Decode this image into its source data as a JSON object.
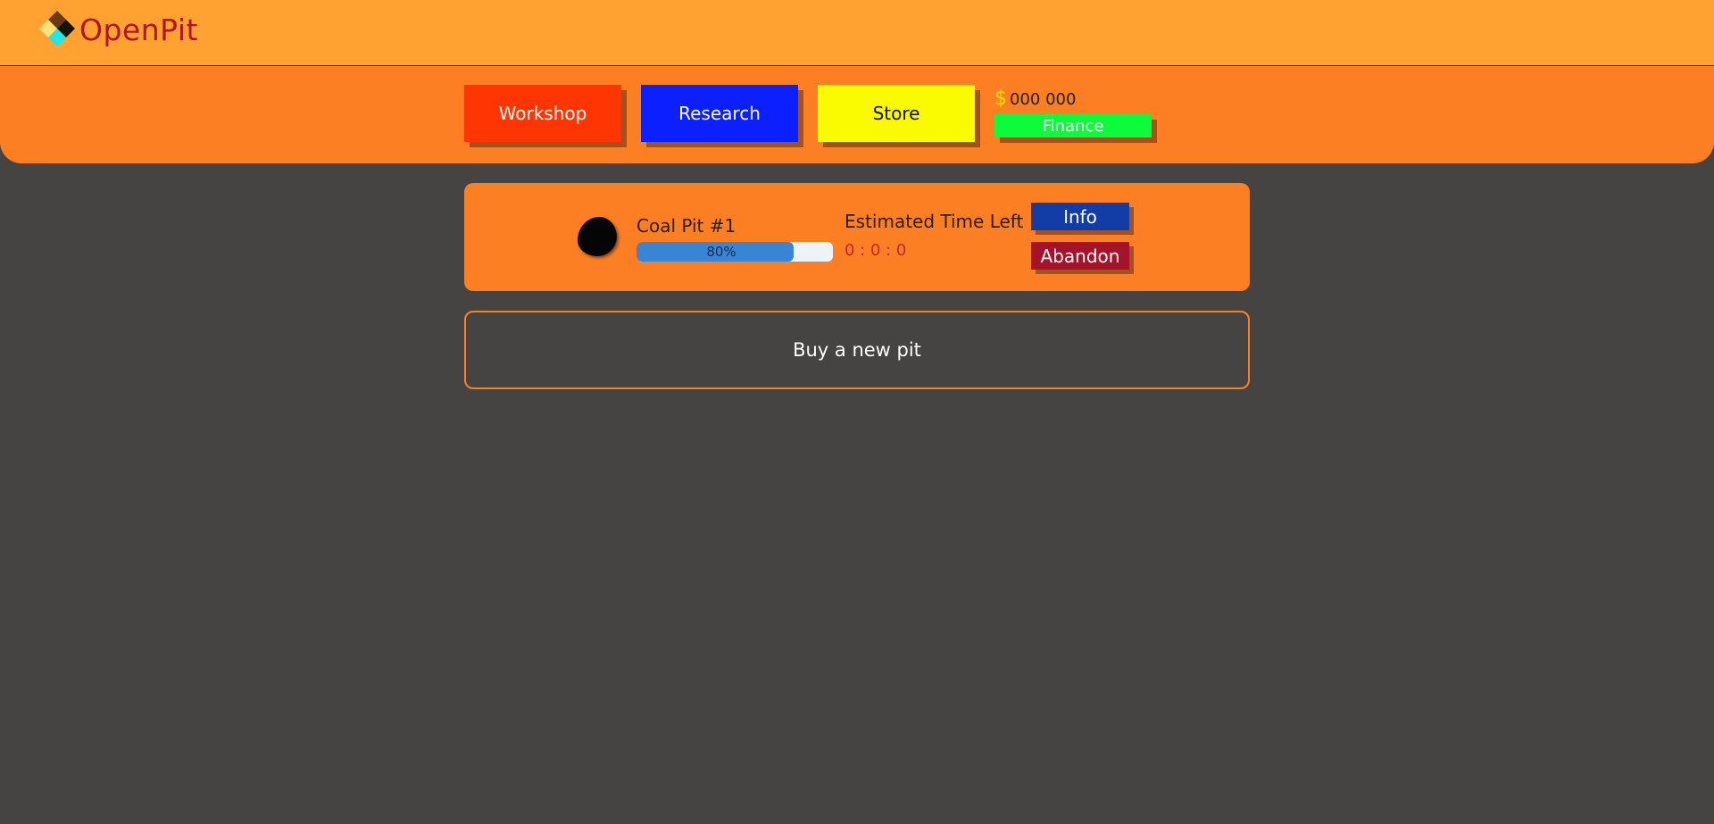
{
  "app": {
    "title": "OpenPit",
    "logo_icon": "diamond-logo-icon"
  },
  "nav": {
    "workshop_label": "Workshop",
    "research_label": "Research",
    "store_label": "Store",
    "money_symbol": "$",
    "money_value": "000 000",
    "finance_label": "Finance"
  },
  "pits": [
    {
      "name": "Coal Pit #1",
      "icon": "coal-icon",
      "progress": 0.8,
      "progress_text": "80%",
      "time_label": "Estimated Time Left :",
      "time_value": "0 : 0 : 0",
      "info_label": "Info",
      "abandon_label": "Abandon"
    }
  ],
  "buy": {
    "label": "Buy a new pit"
  },
  "colors": {
    "background": "#464442",
    "topbar": "#ffa232",
    "navband": "#fc7f23",
    "workshop": "#ff3504",
    "research": "#0c1fff",
    "store": "#fafb00",
    "finance": "#0cfc3c",
    "info": "#133da6",
    "abandon": "#a5122a",
    "progress": "#3885d6"
  }
}
